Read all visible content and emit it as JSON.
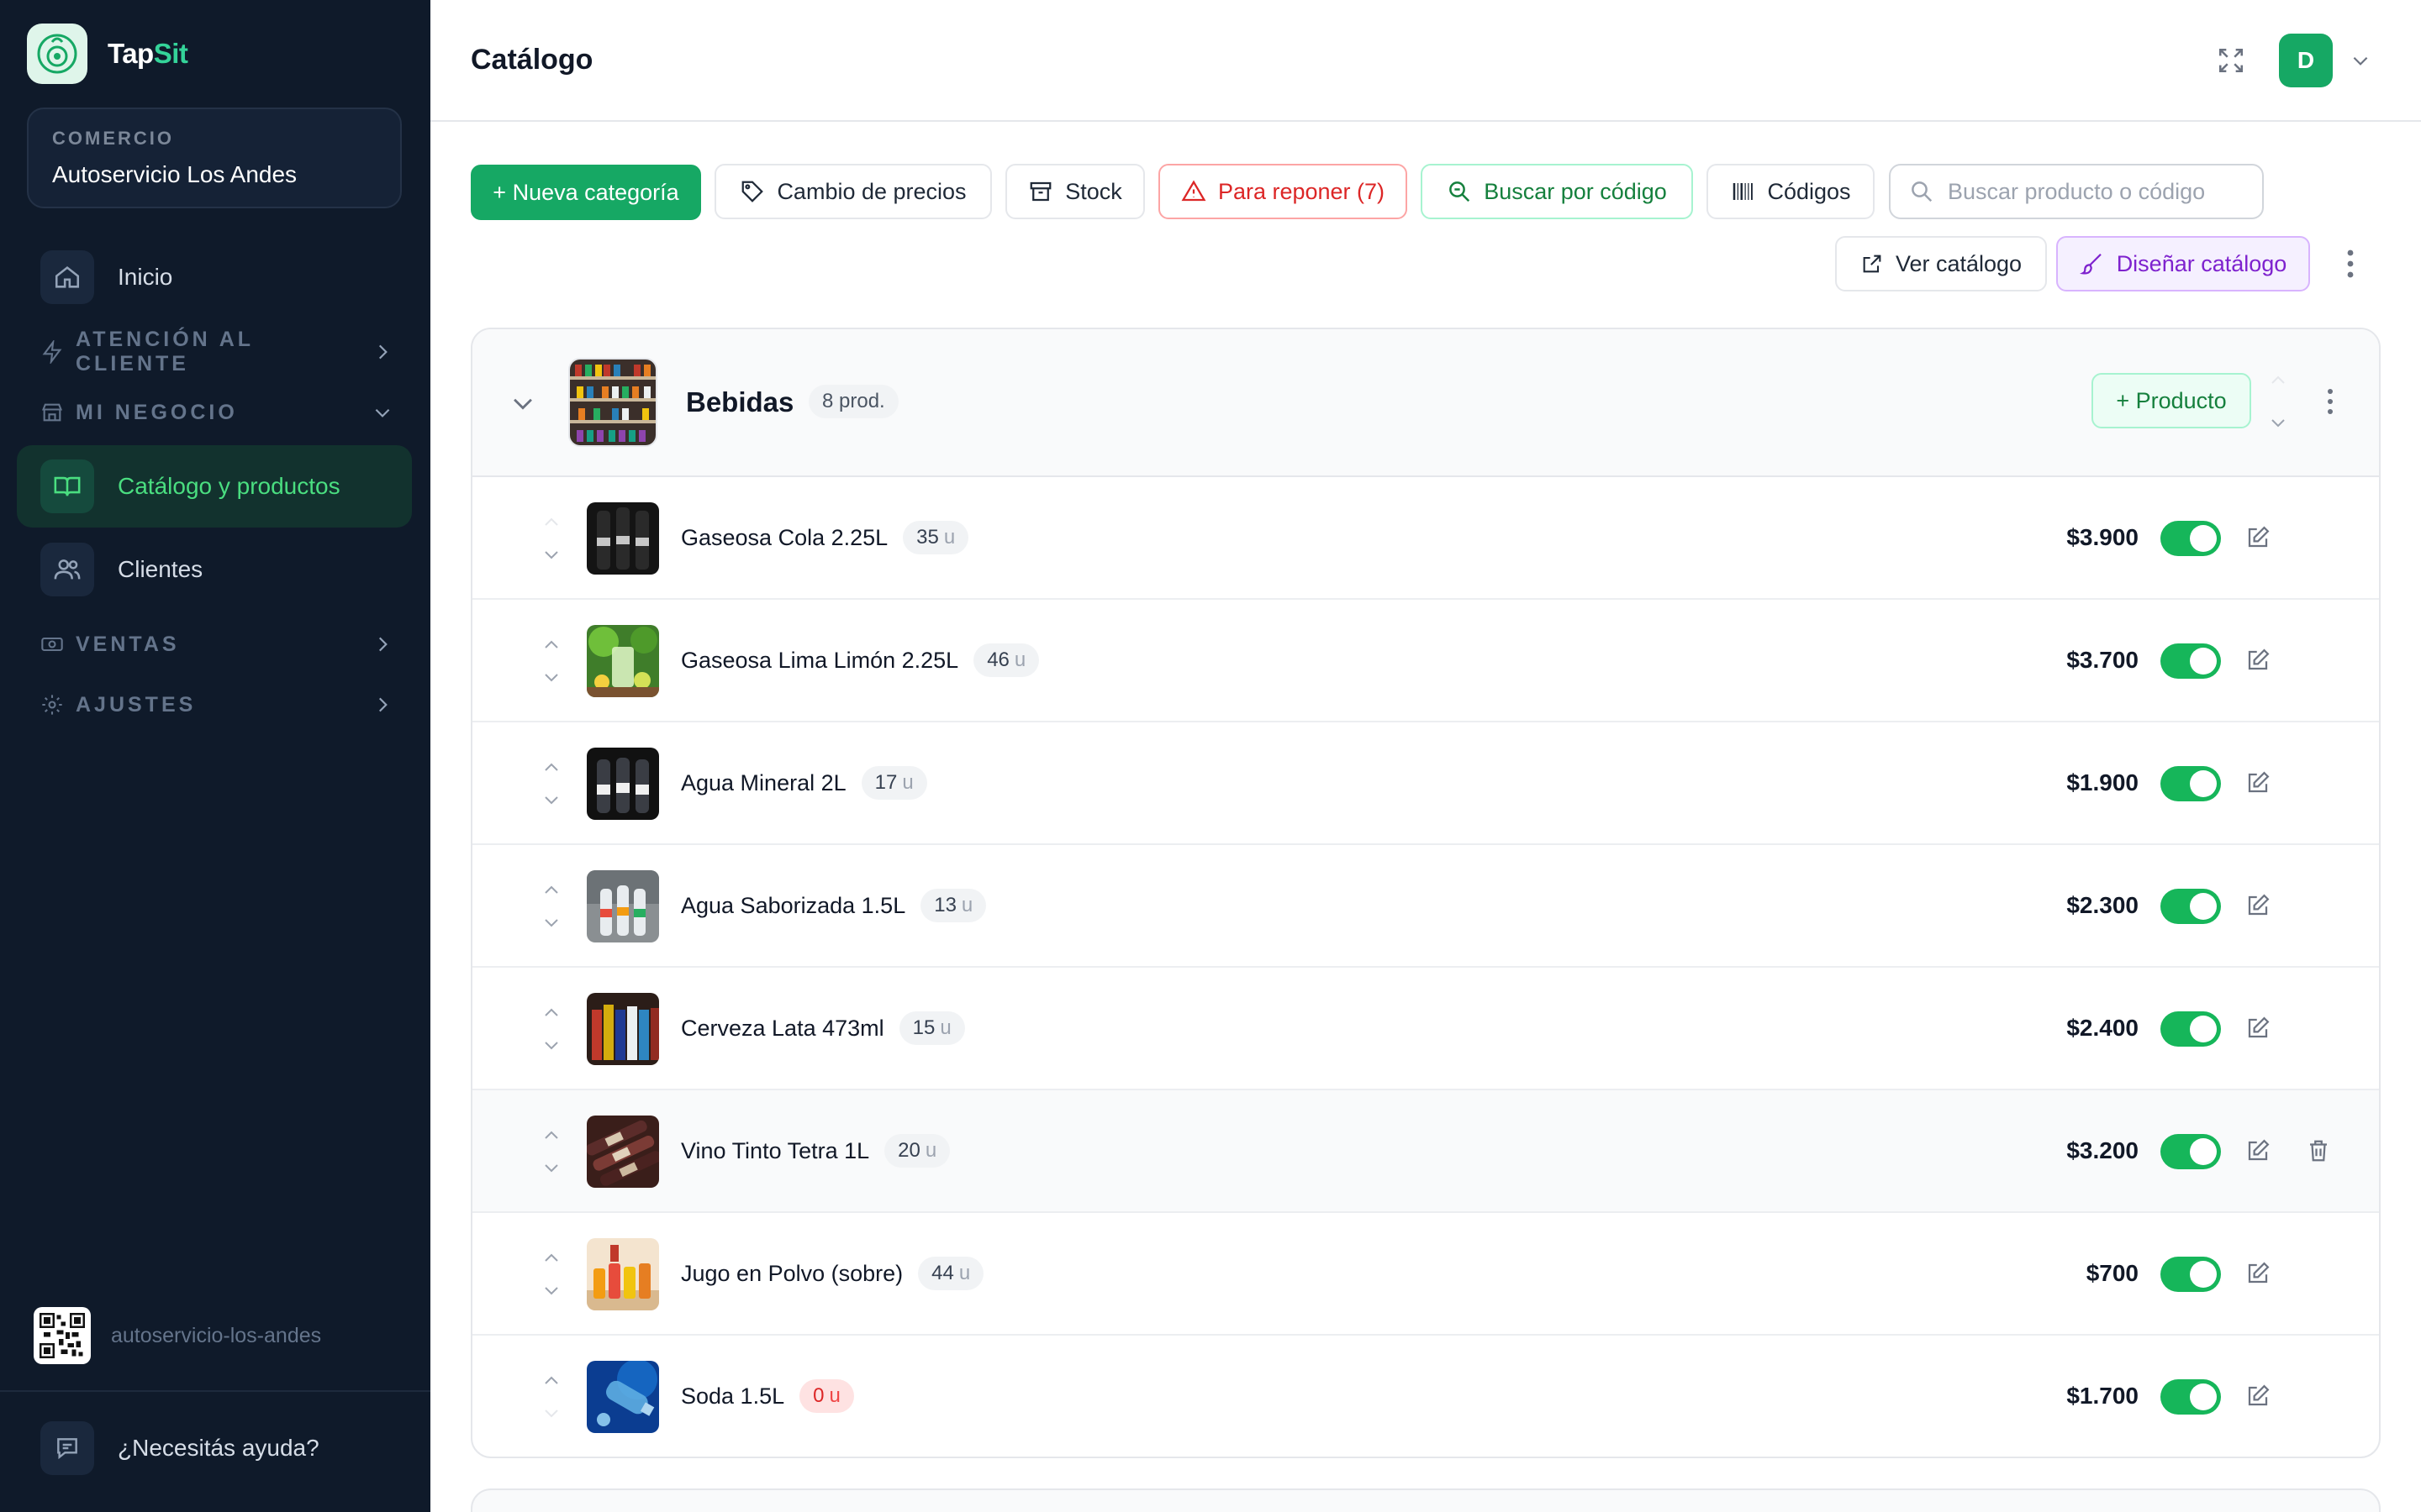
{
  "brand": {
    "name_a": "Tap",
    "name_b": "Sit"
  },
  "store": {
    "label": "COMERCIO",
    "name": "Autoservicio Los Andes"
  },
  "nav": {
    "inicio": "Inicio",
    "atencion": "ATENCIÓN AL CLIENTE",
    "negocio": "MI NEGOCIO",
    "catalogo": "Catálogo y productos",
    "clientes": "Clientes",
    "ventas": "VENTAS",
    "ajustes": "AJUSTES"
  },
  "sidebar_footer": {
    "slug": "autoservicio-los-andes",
    "help": "¿Necesitás ayuda?"
  },
  "header": {
    "title": "Catálogo",
    "avatar_initial": "D"
  },
  "toolbar": {
    "new_category": "+ Nueva categoría",
    "price_change": "Cambio de precios",
    "stock": "Stock",
    "restock": "Para reponer (7)",
    "search_code": "Buscar por código",
    "codes": "Códigos",
    "search_placeholder": "Buscar producto o código",
    "view_catalog": "Ver catálogo",
    "design_catalog": "Diseñar catálogo"
  },
  "category": {
    "name": "Bebidas",
    "count": "8 prod.",
    "add_product": "+ Producto",
    "products": [
      {
        "name": "Gaseosa Cola 2.25L",
        "stock": "35",
        "unit": "u",
        "price": "$3.900",
        "active": true
      },
      {
        "name": "Gaseosa Lima Limón 2.25L",
        "stock": "46",
        "unit": "u",
        "price": "$3.700",
        "active": true
      },
      {
        "name": "Agua Mineral 2L",
        "stock": "17",
        "unit": "u",
        "price": "$1.900",
        "active": true
      },
      {
        "name": "Agua Saborizada 1.5L",
        "stock": "13",
        "unit": "u",
        "price": "$2.300",
        "active": true
      },
      {
        "name": "Cerveza Lata 473ml",
        "stock": "15",
        "unit": "u",
        "price": "$2.400",
        "active": true
      },
      {
        "name": "Vino Tinto Tetra 1L",
        "stock": "20",
        "unit": "u",
        "price": "$3.200",
        "active": true
      },
      {
        "name": "Jugo en Polvo (sobre)",
        "stock": "44",
        "unit": "u",
        "price": "$700",
        "active": true
      },
      {
        "name": "Soda 1.5L",
        "stock": "0",
        "unit": "u",
        "price": "$1.700",
        "active": true
      }
    ]
  },
  "colors": {
    "accent": "#16a864",
    "sidebar_bg": "#0f1a2a",
    "danger": "#dc2626",
    "purple": "#7e22ce"
  }
}
